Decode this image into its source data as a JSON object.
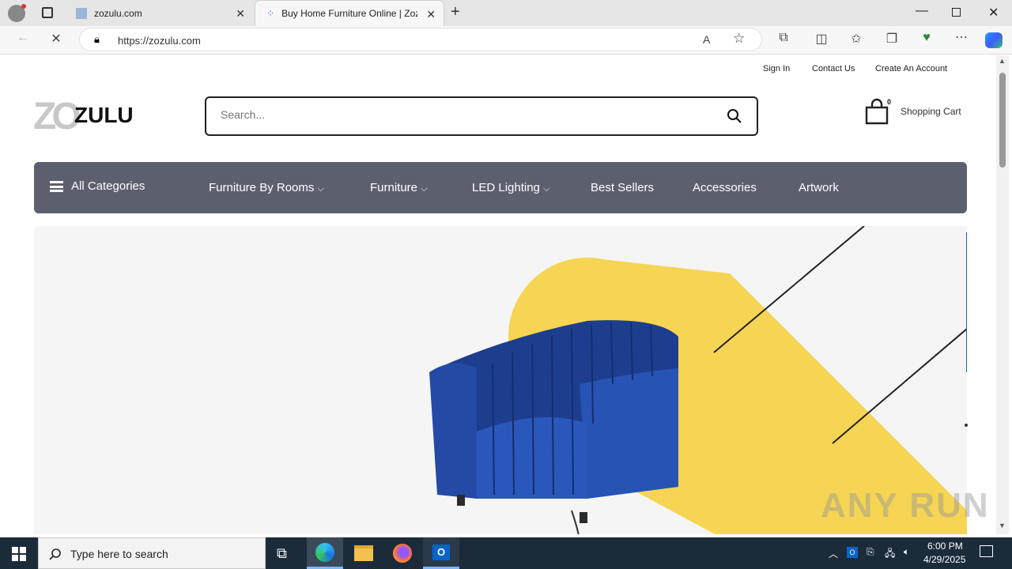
{
  "browser": {
    "tabs": [
      {
        "title": "zozulu.com",
        "active": false
      },
      {
        "title": "Buy Home Furniture Online | Zoz",
        "active": true
      }
    ],
    "url": "https://zozulu.com"
  },
  "site": {
    "top_links": [
      "Sign In",
      "Contact Us",
      "Create An Account"
    ],
    "logo_text": "ZULU",
    "logo_mark": "ZO",
    "search_placeholder": "Search...",
    "cart_count": "0",
    "cart_label": "Shopping Cart",
    "nav": {
      "all_categories": "All Categories",
      "items": [
        {
          "label": "Furniture By Rooms",
          "dropdown": true
        },
        {
          "label": "Furniture",
          "dropdown": true
        },
        {
          "label": "LED Lighting",
          "dropdown": true
        },
        {
          "label": "Best Sellers",
          "dropdown": false
        },
        {
          "label": "Accessories",
          "dropdown": false
        },
        {
          "label": "Artwork",
          "dropdown": false
        }
      ]
    }
  },
  "watermark": "ANY RUN",
  "taskbar": {
    "search_placeholder": "Type here to search",
    "time": "6:00 PM",
    "date": "4/29/2025"
  },
  "colors": {
    "nav_bg": "#5c5f6e",
    "hero_yellow": "#f6d454",
    "chair_blue": "#1d3e8f"
  }
}
